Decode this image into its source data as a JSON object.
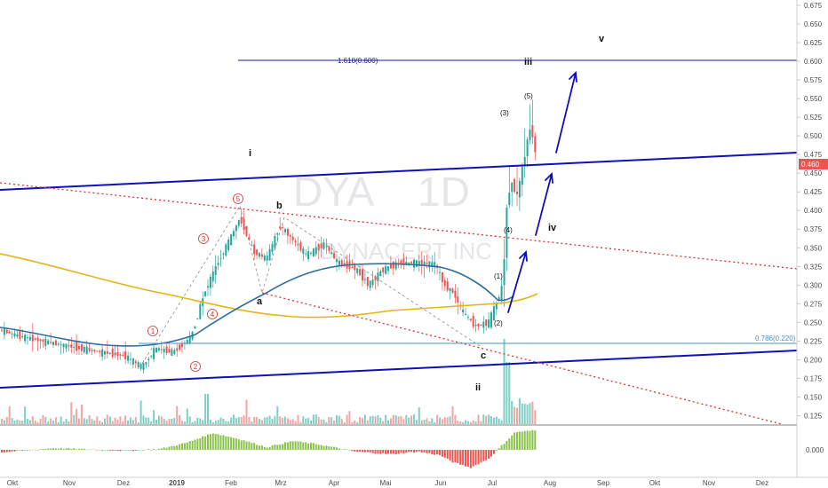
{
  "chart_data": {
    "type": "line",
    "symbol": "DYA",
    "interval": "1D",
    "company": "DYNACERT INC",
    "price_axis": {
      "ticks": [
        "0.675",
        "0.650",
        "0.625",
        "0.600",
        "0.575",
        "0.550",
        "0.525",
        "0.500",
        "0.475",
        "0.450",
        "0.425",
        "0.400",
        "0.375",
        "0.350",
        "0.325",
        "0.300",
        "0.275",
        "0.250",
        "0.225",
        "0.200",
        "0.175",
        "0.150",
        "0.125"
      ],
      "ylim": [
        0.11,
        0.685
      ]
    },
    "current_price": "0.460",
    "oscillator_tick": "0.000",
    "x_labels": [
      "Okt",
      "Nov",
      "Dez",
      "2019",
      "Feb",
      "Mrz",
      "Apr",
      "Mai",
      "Jun",
      "Jul",
      "Aug",
      "Sep",
      "Okt",
      "Nov",
      "Dez"
    ],
    "fib_levels": [
      {
        "label": "1.618(0.600)",
        "value": 0.6,
        "color": "#1a1a9c"
      },
      {
        "label": "0.786(0.220)",
        "value": 0.22,
        "color": "#4a90c2"
      }
    ],
    "wave_labels": {
      "major": [
        "i",
        "ii",
        "iii",
        "iv",
        "v"
      ],
      "corrective": [
        "a",
        "b",
        "c"
      ],
      "circled": [
        "1",
        "2",
        "3",
        "4",
        "5"
      ],
      "sub": [
        "(1)",
        "(2)",
        "(3)",
        "(4)",
        "(5)"
      ]
    },
    "series": [
      {
        "name": "",
        "color": "#e2b616"
      },
      {
        "name": "",
        "color": "#2f6ea0"
      }
    ],
    "colors": {
      "up": "#26a69a",
      "down": "#ef5350",
      "channel": "#1010b8",
      "red_dotted": "#e03030",
      "arrow": "#1010b8",
      "price_tag": "#ef5350"
    }
  }
}
